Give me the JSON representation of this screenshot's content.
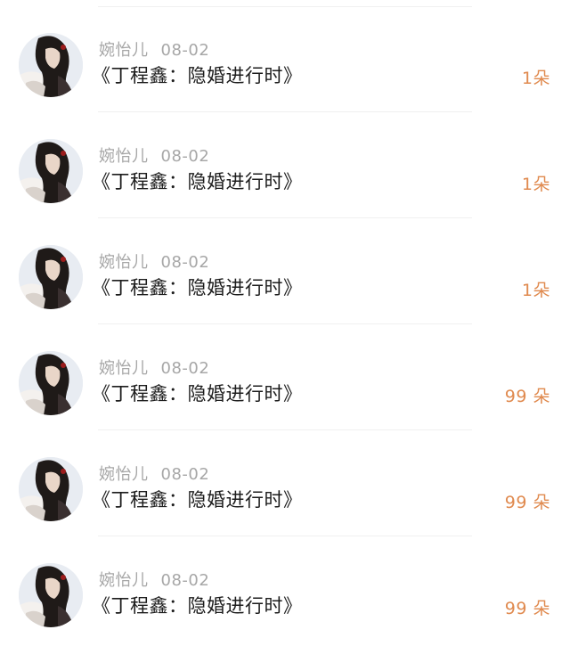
{
  "gifts": [
    {
      "user": "婉怡儿",
      "date": "08-02",
      "title": "《丁程鑫：隐婚进行时》",
      "amount": "1朵"
    },
    {
      "user": "婉怡儿",
      "date": "08-02",
      "title": "《丁程鑫：隐婚进行时》",
      "amount": "1朵"
    },
    {
      "user": "婉怡儿",
      "date": "08-02",
      "title": "《丁程鑫：隐婚进行时》",
      "amount": "1朵"
    },
    {
      "user": "婉怡儿",
      "date": "08-02",
      "title": "《丁程鑫：隐婚进行时》",
      "amount": "99 朵"
    },
    {
      "user": "婉怡儿",
      "date": "08-02",
      "title": "《丁程鑫：隐婚进行时》",
      "amount": "99 朵"
    },
    {
      "user": "婉怡儿",
      "date": "08-02",
      "title": "《丁程鑫：隐婚进行时》",
      "amount": "99 朵"
    }
  ],
  "colors": {
    "amount": "#e08a4f",
    "meta": "#a7a7a7",
    "title": "#1c1c1c"
  }
}
